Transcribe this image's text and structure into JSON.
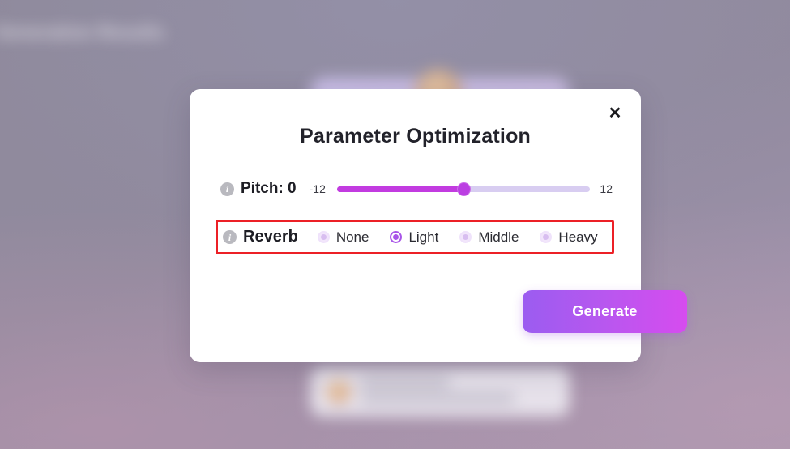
{
  "background": {
    "heading": "Generation Results",
    "card_line_1": "Caroline",
    "card_line_2": "My 30 tips after voice convert"
  },
  "modal": {
    "title": "Parameter Optimization",
    "close_icon": "close-icon",
    "pitch": {
      "info_icon": "info-icon",
      "label": "Pitch: 0",
      "min_label": "-12",
      "max_label": "12",
      "value": 0,
      "min": -12,
      "max": 12
    },
    "reverb": {
      "info_icon": "info-icon",
      "label": "Reverb",
      "selected": "Light",
      "options": [
        {
          "label": "None",
          "selected": false
        },
        {
          "label": "Light",
          "selected": true
        },
        {
          "label": "Middle",
          "selected": false
        },
        {
          "label": "Heavy",
          "selected": false
        }
      ]
    },
    "generate_label": "Generate"
  },
  "annotation": {
    "color": "#ec2026",
    "target": "reverb-row"
  },
  "colors": {
    "accent_purple": "#a855e8",
    "slider_fill": "#c23be0",
    "slider_track": "#d8cdf1",
    "button_gradient_start": "#9b5cf0",
    "button_gradient_end": "#d64cef",
    "backdrop": "#8e8799"
  }
}
